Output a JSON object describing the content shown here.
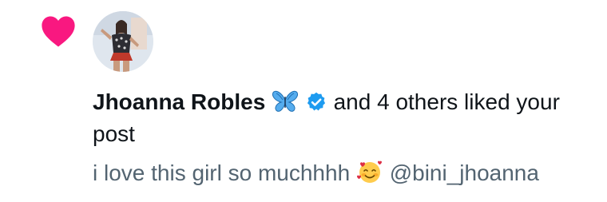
{
  "notification": {
    "type_icon": "heart-icon",
    "accent_color": "#f91880",
    "avatar": {
      "description_icon": "user-avatar"
    },
    "liker_name": "Jhoanna Robles",
    "name_emoji_icon": "butterfly-emoji-icon",
    "verified_icon": "verified-badge-icon",
    "verified_color": "#1d9bf0",
    "action_text": "and 4 others liked your post",
    "post": {
      "text_before_emoji": "i love this girl so muchhhh",
      "emoji_icon": "smiling-face-with-hearts-emoji-icon",
      "mention": "@bini_jhoanna"
    }
  }
}
